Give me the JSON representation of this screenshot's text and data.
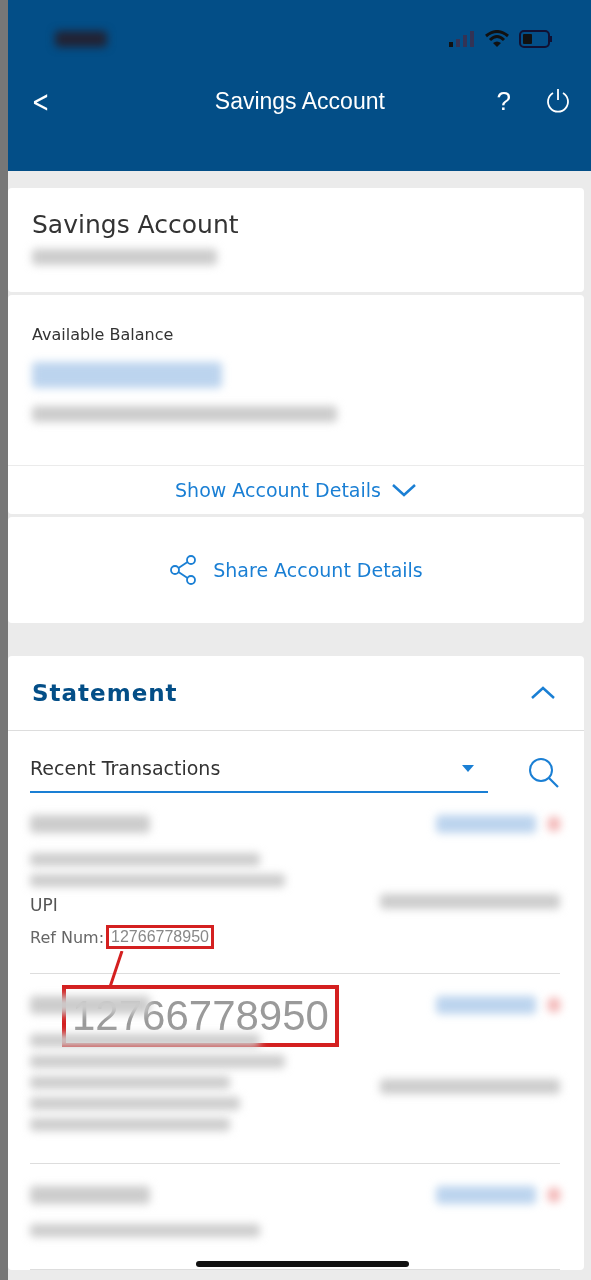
{
  "header": {
    "title": "Savings Account",
    "back": "<",
    "help": "?"
  },
  "account_card": {
    "title": "Savings Account"
  },
  "balance_card": {
    "label": "Available Balance"
  },
  "show_details": {
    "label": "Show Account Details",
    "expanded": false
  },
  "share": {
    "label": "Share Account Details"
  },
  "statement": {
    "title": "Statement",
    "expanded": true,
    "filter": {
      "value": "Recent Transactions"
    },
    "transactions": [
      {
        "kind": "detailed",
        "channel": "UPI",
        "ref_label": "Ref Num:",
        "ref_num": "12766778950"
      },
      {
        "kind": "blurred"
      },
      {
        "kind": "partial"
      }
    ]
  },
  "annotation": {
    "text": "12766778950"
  }
}
